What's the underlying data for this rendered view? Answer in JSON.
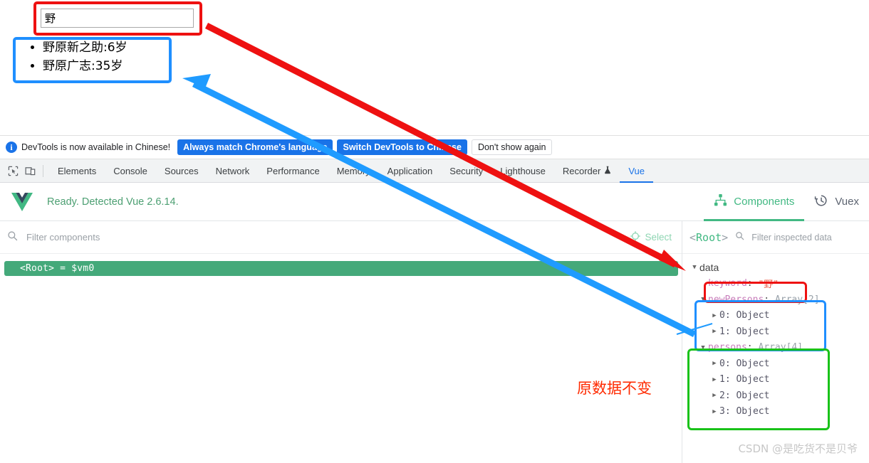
{
  "page": {
    "search_value": "野",
    "search_placeholder": "",
    "results": [
      "野原新之助:6岁",
      "野原广志:35岁"
    ]
  },
  "notice": {
    "icon": "info-icon",
    "text": "DevTools is now available in Chinese!",
    "btn_always": "Always match Chrome's language",
    "btn_switch": "Switch DevTools to Chinese",
    "btn_dismiss": "Don't show again"
  },
  "devtools_tabs": {
    "inspect_icon": "inspect-element-icon",
    "device_icon": "device-toolbar-icon",
    "items": [
      {
        "label": "Elements",
        "active": false
      },
      {
        "label": "Console",
        "active": false
      },
      {
        "label": "Sources",
        "active": false
      },
      {
        "label": "Network",
        "active": false
      },
      {
        "label": "Performance",
        "active": false
      },
      {
        "label": "Memory",
        "active": false
      },
      {
        "label": "Application",
        "active": false
      },
      {
        "label": "Security",
        "active": false
      },
      {
        "label": "Lighthouse",
        "active": false
      },
      {
        "label": "Recorder",
        "active": false
      },
      {
        "label": "Vue",
        "active": true
      }
    ]
  },
  "vue_panel": {
    "logo": "vue-logo-icon",
    "status": "Ready. Detected Vue 2.6.14.",
    "tabs": [
      {
        "label": "Components",
        "icon": "components-icon",
        "active": true
      },
      {
        "label": "Vuex",
        "icon": "vuex-history-icon",
        "active": false
      }
    ],
    "filter_placeholder": "Filter components",
    "filter_value": "",
    "select_label": "Select",
    "select_icon": "target-select-icon",
    "root_row": "<Root> = $vm0"
  },
  "inspector": {
    "root_label": "<Root>",
    "root_open": "<",
    "root_name": "Root",
    "root_close": ">",
    "filter_placeholder": "Filter inspected data",
    "filter_value": "",
    "section": "data",
    "keyword": {
      "key": "keyword",
      "value": "\"野\""
    },
    "newPersons": {
      "key": "newPersons",
      "type": "Array[2]",
      "children": [
        "0: Object",
        "1: Object"
      ]
    },
    "persons": {
      "key": "persons",
      "type": "Array[4]",
      "children": [
        "0: Object",
        "1: Object",
        "2: Object",
        "3: Object"
      ]
    }
  },
  "annotations": {
    "note": "原数据不变",
    "colors": {
      "red": "#ee1111",
      "blue": "#1f8fff",
      "green": "#19c219",
      "note_red": "#ff2a00",
      "vue_green": "#42b983"
    }
  },
  "watermark": "CSDN @是吃货不是贝爷"
}
